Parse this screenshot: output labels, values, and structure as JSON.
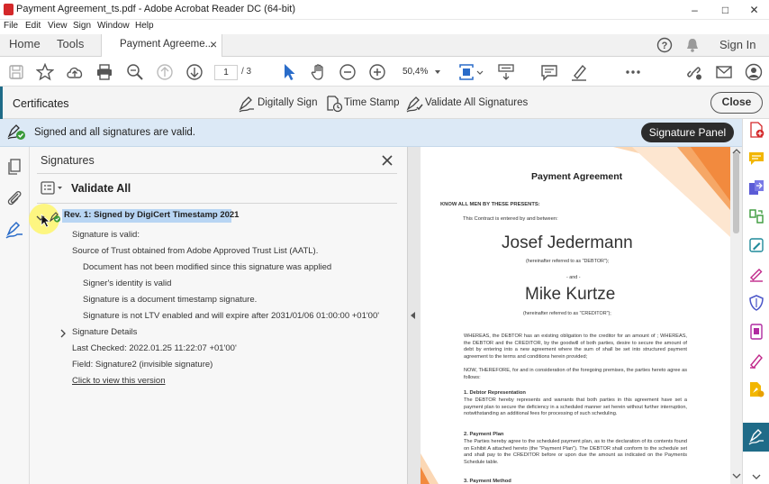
{
  "window": {
    "title": "Payment Agreement_ts.pdf - Adobe Acrobat Reader DC (64-bit)",
    "minimize_glyph": "–",
    "maximize_glyph": "□",
    "close_glyph": "✕"
  },
  "menu": [
    "File",
    "Edit",
    "View",
    "Sign",
    "Window",
    "Help"
  ],
  "tabs": {
    "home": "Home",
    "tools": "Tools",
    "document": "Payment Agreeme...",
    "close_glyph": "×",
    "sign_in": "Sign In"
  },
  "toolbar": {
    "page_current": "1",
    "page_total": "/ 3",
    "zoom": "50,4%"
  },
  "certificates": {
    "title": "Certificates",
    "digitally_sign": "Digitally Sign",
    "time_stamp": "Time Stamp",
    "validate_all": "Validate All Signatures",
    "close": "Close"
  },
  "signature_bar": {
    "message": "Signed and all signatures are valid.",
    "panel_button": "Signature Panel"
  },
  "panel": {
    "title": "Signatures",
    "validate_all": "Validate All",
    "revision": "Rev. 1: Signed by DigiCert Timestamp 2021",
    "lines": [
      "Signature is valid:",
      "Source of Trust obtained from Adobe Approved Trust List (AATL)."
    ],
    "sublines": [
      "Document has not been modified since this signature was applied",
      "Signer's identity is valid",
      "Signature is a document timestamp signature.",
      "Signature is not LTV enabled and will expire after 2031/01/06 01:00:00 +01'00'"
    ],
    "details": "Signature Details",
    "last_checked": "Last Checked: 2022.01.25 11:22:07 +01'00'",
    "field": "Field: Signature2 (invisible signature)",
    "view_version": "Click to view this version"
  },
  "document": {
    "title": "Payment Agreement",
    "know_all": "KNOW ALL MEN BY THESE PRESENTS:",
    "entered": "This Contract is entered by and between:",
    "party1": "Josef Jedermann",
    "party1_ref": "(hereinafter referred to as \"DEBTOR\");",
    "and": "- and -",
    "party2": "Mike Kurtze",
    "party2_ref": "(hereinafter referred to as \"CREDITOR\");",
    "whereas": "WHEREAS, the DEBTOR has an existing obligation to the creditor for an amount of ; WHEREAS, the DEBTOR and the CREDITOR, by the goodwill of both parties, desire to secure the amount of debt by entering into a new agreement where the sum of shall be set into structured payment agreement to the terms and conditions herein provided;",
    "now_therefore": "NOW, THEREFORE, for and in consideration of the foregoing premises, the parties hereto agree as follows:",
    "s1_title": "1. Debtor Representation",
    "s1_text": "The DEBTOR hereby represents and warrants that both parties in this agreement have set a payment plan to secure the deficiency in a scheduled manner set herein without further interruption, notwithstanding an additional fees for processing of such scheduling.",
    "s2_title": "2. Payment Plan",
    "s2_text": "The Parties hereby agree to the scheduled payment plan, as to the declaration of its contents found on Exhibit A attached hereto (the \"Payment Plan\"). The DEBTOR shall conform to the schedule set and shall pay to the CREDITOR before or upon due the amount as indicated on the Payments Schedule table.",
    "s3_title": "3. Payment Method"
  },
  "colors": {
    "accent_blue": "#2a6cc9",
    "info_bar": "#dce9f6",
    "selection": "#b8d5f3",
    "valid_green": "#3a9a3a",
    "doc_orange": "#f28a3e",
    "right_active": "#1f6b88"
  },
  "icons": {
    "right_rail": [
      "add-pdf-icon",
      "comment-icon",
      "export-pdf-icon",
      "organize-pages-icon",
      "edit-pdf-icon",
      "fill-sign-icon",
      "protect-icon",
      "compress-icon",
      "redact-icon",
      "request-signature-icon",
      "certificates-icon"
    ]
  }
}
